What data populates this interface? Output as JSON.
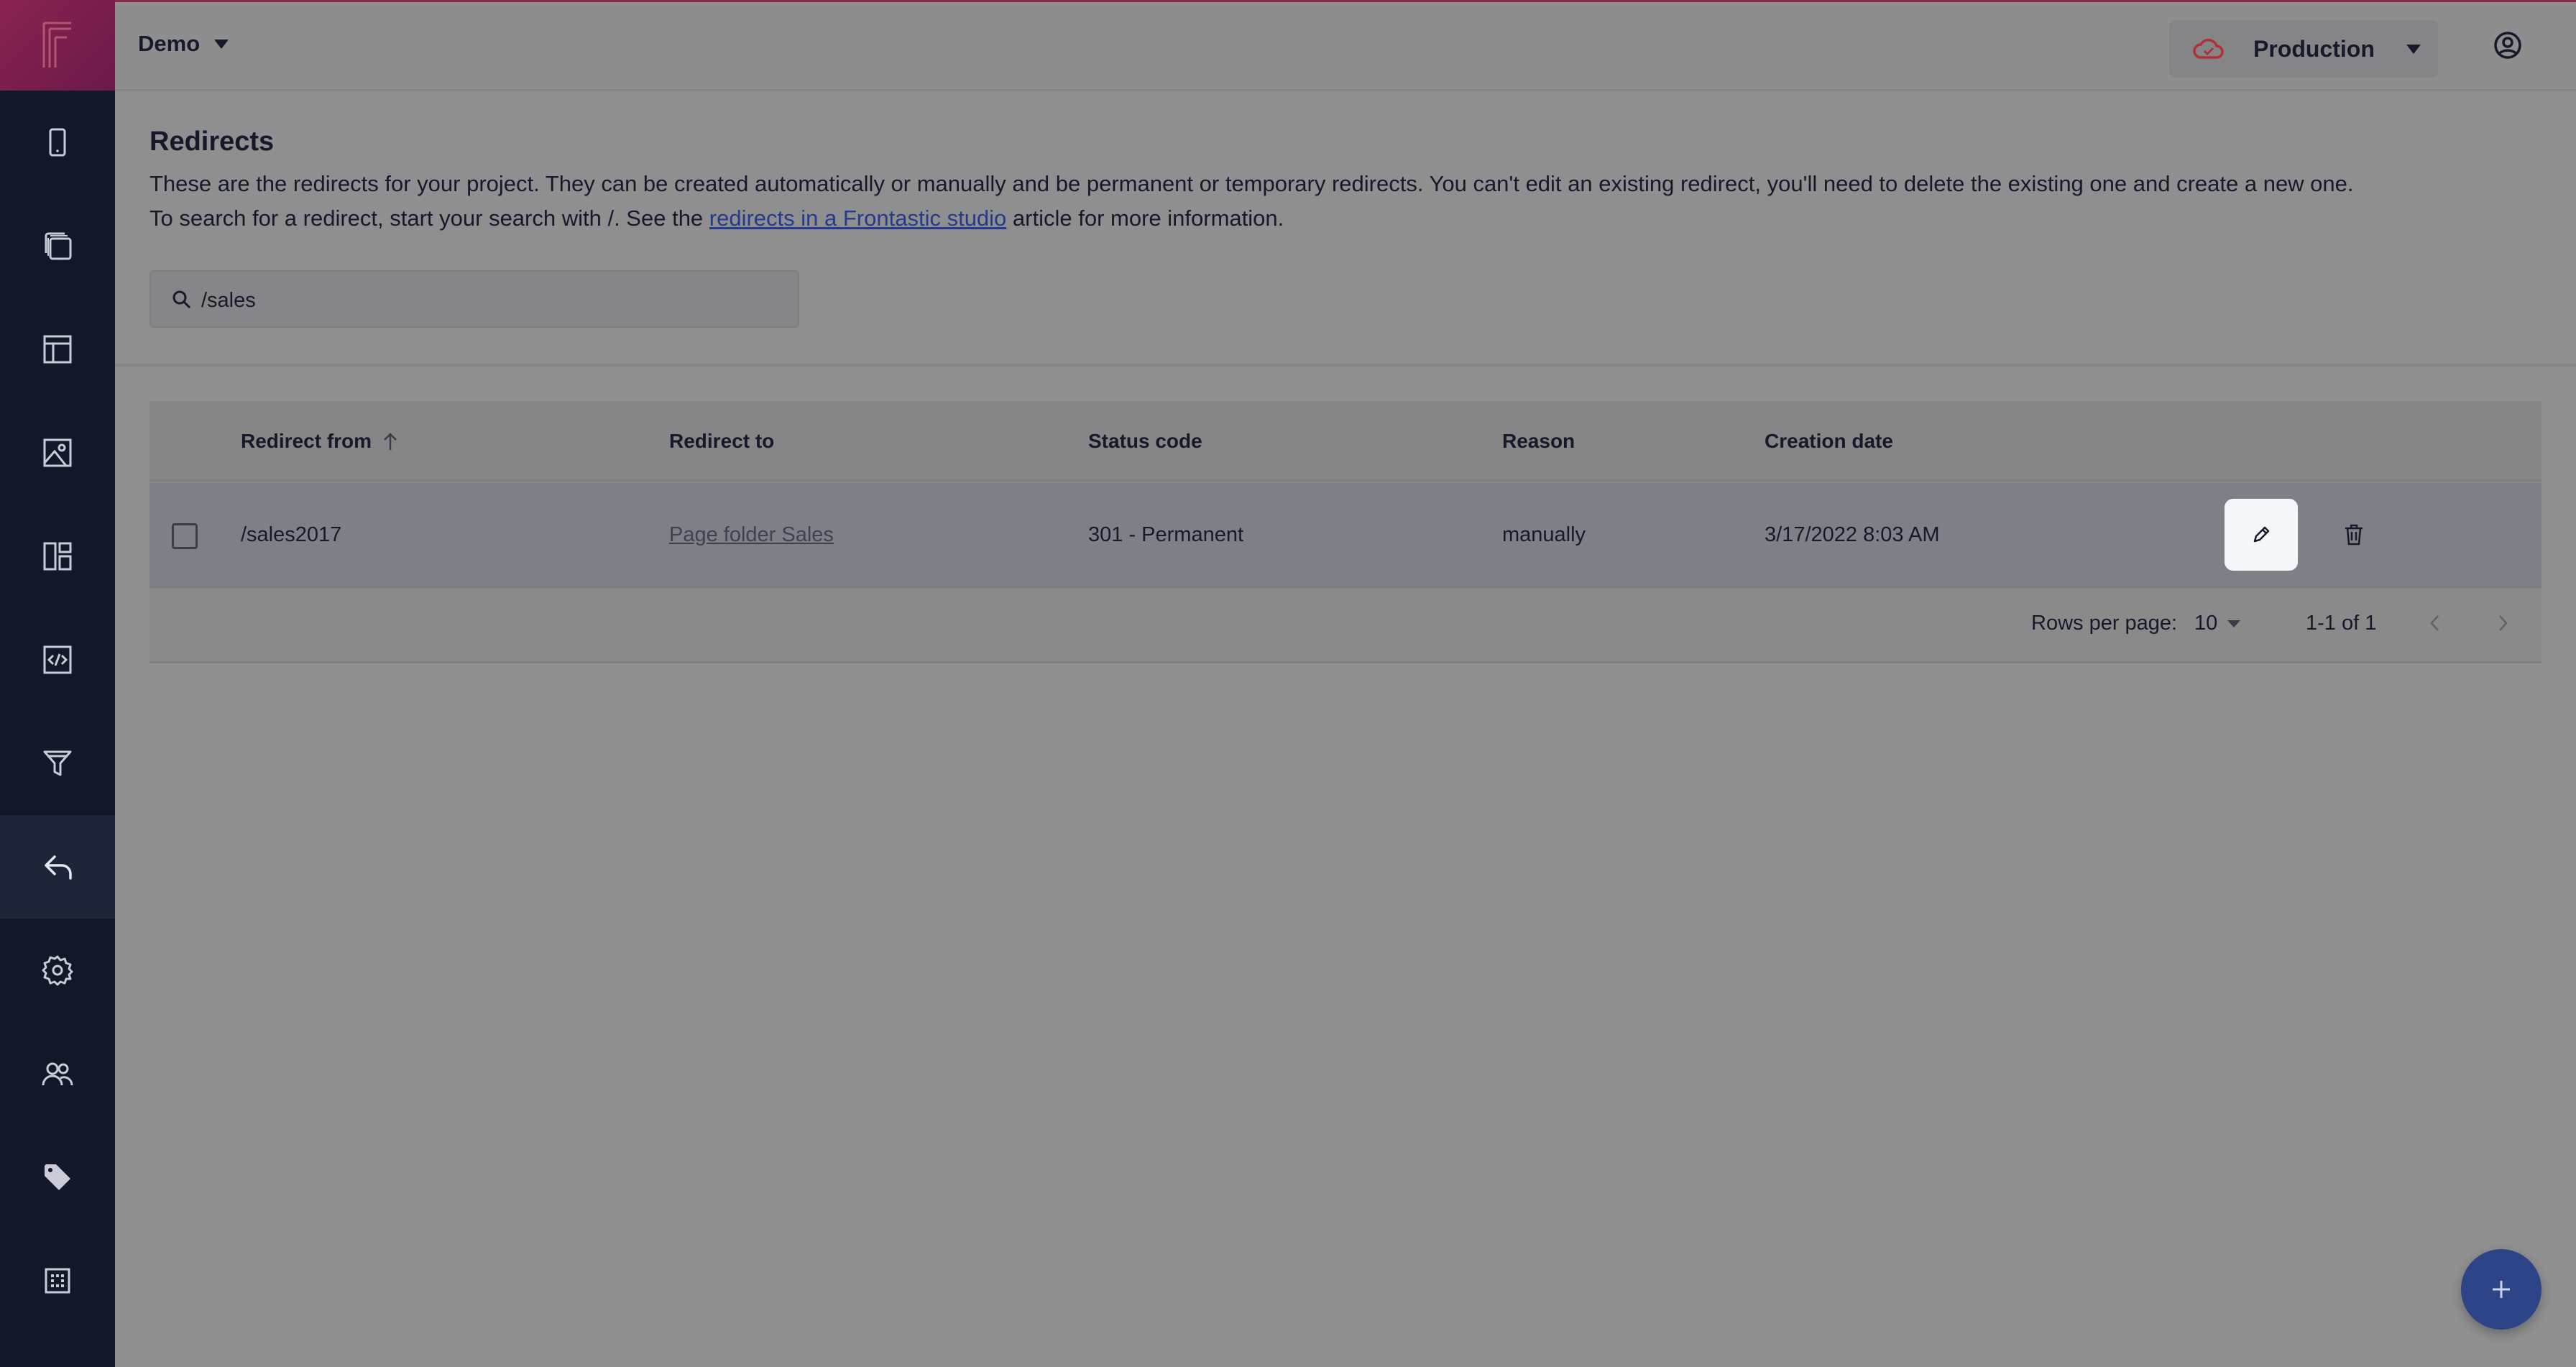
{
  "app": {
    "project": "Demo",
    "environment": "Production"
  },
  "sidebar": {
    "items": [
      {
        "name": "device",
        "icon": "mobile-device-icon",
        "active": false
      },
      {
        "name": "pages",
        "icon": "copy-pages-icon",
        "active": false
      },
      {
        "name": "layout",
        "icon": "layout-icon",
        "active": false
      },
      {
        "name": "media",
        "icon": "image-icon",
        "active": false
      },
      {
        "name": "components",
        "icon": "components-grid-icon",
        "active": false
      },
      {
        "name": "developer",
        "icon": "code-icon",
        "active": false
      },
      {
        "name": "filters",
        "icon": "funnel-icon",
        "active": false
      },
      {
        "name": "redirects",
        "icon": "reply-arrow-icon",
        "active": true
      },
      {
        "name": "settings",
        "icon": "gear-icon",
        "active": false
      },
      {
        "name": "users",
        "icon": "users-icon",
        "active": false
      },
      {
        "name": "tags",
        "icon": "tag-icon",
        "active": false
      },
      {
        "name": "other",
        "icon": "grid-dots-icon",
        "active": false
      }
    ]
  },
  "page": {
    "title": "Redirects",
    "description_line1": "These are the redirects for your project. They can be created automatically or manually and be permanent or temporary redirects. You can't edit an existing redirect, you'll need to delete the existing one and create a new one.",
    "description_line2_prefix": "To search for a redirect, start your search with /. See the ",
    "description_link": "redirects in a Frontastic studio",
    "description_line2_suffix": " article for more information."
  },
  "search": {
    "value": "/sales",
    "placeholder": ""
  },
  "table": {
    "columns": {
      "from": "Redirect from",
      "to": "Redirect to",
      "status": "Status code",
      "reason": "Reason",
      "date": "Creation date"
    },
    "rows": [
      {
        "from": "/sales2017",
        "to": "Page folder Sales",
        "status": "301 - Permanent",
        "reason": "manually",
        "date": "3/17/2022 8:03 AM"
      }
    ],
    "rows_per_page_label": "Rows per page:",
    "rows_per_page": "10",
    "range": "1-1 of 1"
  },
  "colors": {
    "accent": "#2d4486",
    "sidebar": "#121829",
    "logo": "#8a2350",
    "cloud": "#b0303a"
  }
}
